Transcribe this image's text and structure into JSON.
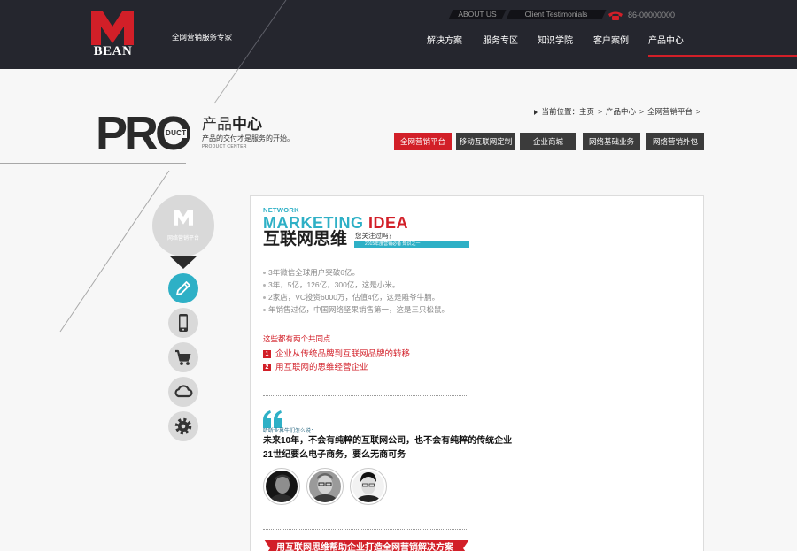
{
  "colors": {
    "header_bg": "#25262e",
    "accent_red": "#d21f28",
    "accent_cyan": "#2eb0c6",
    "tab_dark": "#3b3b3b",
    "circle_gray": "#d9d9d9"
  },
  "header": {
    "logo_mark": "M",
    "logo_name": "BEAN",
    "slogan": "全网营销服务专家",
    "top_links": [
      "ABOUT US",
      "Client Testimonials"
    ],
    "phone_icon": "phone-icon",
    "phone": "86-00000000",
    "nav": [
      {
        "label": "解决方案",
        "active": false
      },
      {
        "label": "服务专区",
        "active": false
      },
      {
        "label": "知识学院",
        "active": false
      },
      {
        "label": "客户案例",
        "active": false
      },
      {
        "label": "产品中心",
        "active": true
      }
    ]
  },
  "page_heading": {
    "logo_word": "PRO",
    "logo_word_small": "DUCT",
    "title_light": "产品",
    "title_bold": "中心",
    "subtitle": "产品的交付才是服务的开始。",
    "caption": "PRODUCT CENTER"
  },
  "breadcrumb": {
    "icon": "triangle-right-icon",
    "label": "当前位置：",
    "items": [
      "主页",
      "产品中心",
      "全网营销平台"
    ],
    "separator": ">"
  },
  "category_tabs": [
    {
      "label": "全网营销平台",
      "active": true
    },
    {
      "label": "移动互联网定制",
      "active": false
    },
    {
      "label": "企业商城",
      "active": false
    },
    {
      "label": "网络基础业务",
      "active": false
    },
    {
      "label": "网络营销外包",
      "active": false
    }
  ],
  "sidebar": {
    "badge_mark": "M",
    "badge_label": "网络营销平台",
    "icons": [
      {
        "name": "pencil-icon",
        "active": true
      },
      {
        "name": "mobile-phone-icon",
        "active": false
      },
      {
        "name": "shopping-cart-icon",
        "active": false
      },
      {
        "name": "cloud-icon",
        "active": false
      },
      {
        "name": "gear-icon",
        "active": false
      }
    ]
  },
  "article": {
    "kicker": "NETWORK",
    "headline_en_1": "MARKETING",
    "headline_en_2": "IDEA",
    "headline_cn": "互联网思维",
    "question": "您关注过吗？",
    "tag": "2015年度营销必备 知识之一",
    "facts": [
      "3年微信全球用户突破6亿。",
      "3年，5亿，126亿，300亿，这是小米。",
      "2家店，VC投资6000万，估值4亿，这是雕爷牛腩。",
      "年销售过亿，中国网络坚果销售第一，这是三只松鼠。"
    ],
    "common_title": "这些都有两个共同点",
    "common_points": [
      {
        "num": "1",
        "text": "企业从传统品牌到互联网品牌的转移"
      },
      {
        "num": "2",
        "text": "用互联网的思维经营企业"
      }
    ],
    "quote_icon": "quote-icon",
    "quote_intro": "听听业界牛们怎么说：",
    "quote_lines": [
      "未来10年，不会有纯粹的互联网公司，也不会有纯粹的传统企业",
      "21世纪要么电子商务，要么无商可务"
    ],
    "banner": "用互联网思维帮助企业打造全网营销解决方案"
  }
}
